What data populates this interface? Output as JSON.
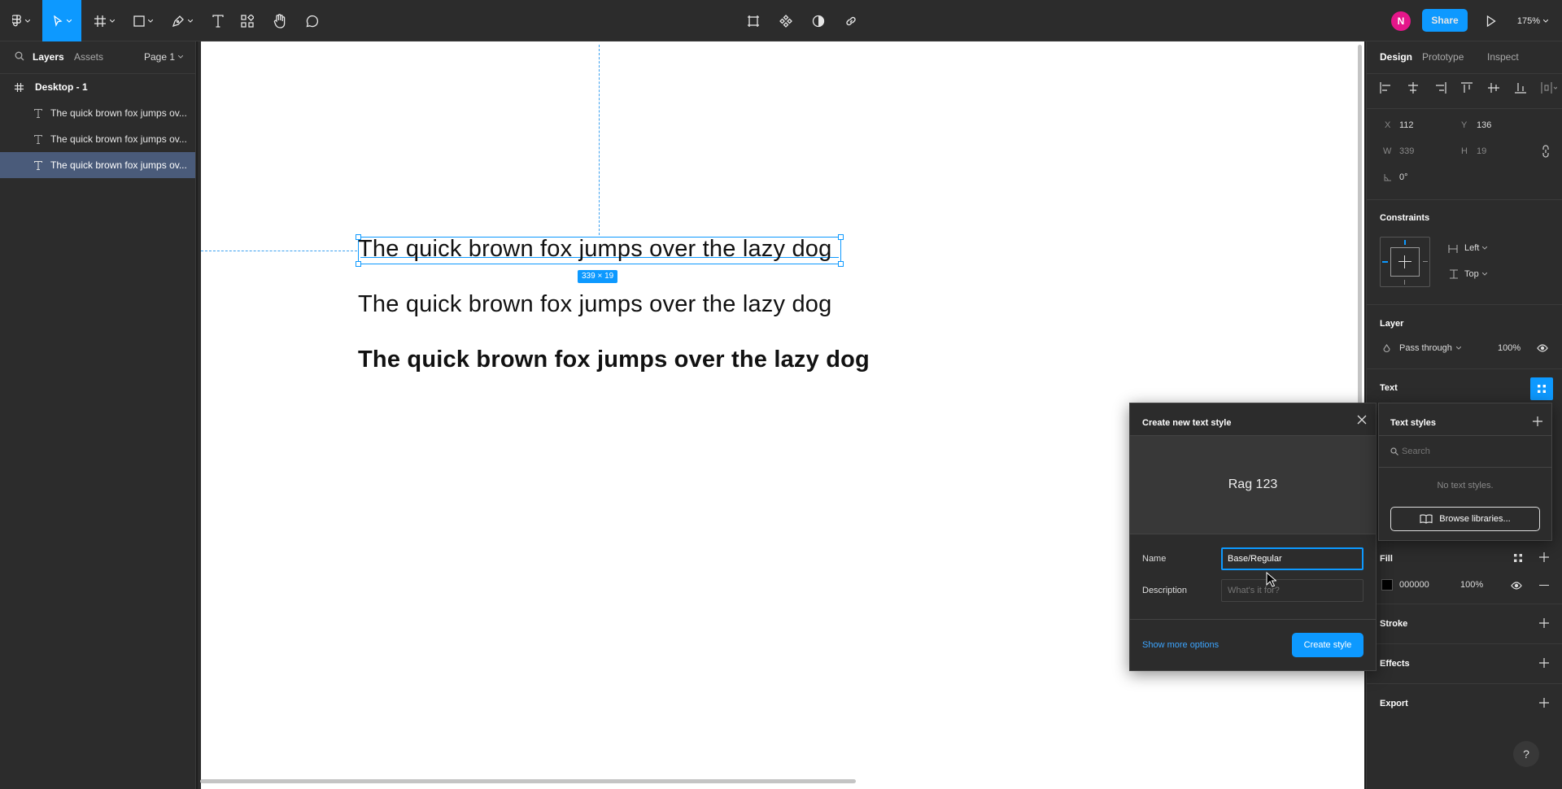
{
  "toolbar": {
    "share_label": "Share",
    "zoom_label": "175%",
    "avatar_initial": "N"
  },
  "left_panel": {
    "tab_layers": "Layers",
    "tab_assets": "Assets",
    "page_label": "Page 1",
    "frame_name": "Desktop - 1",
    "layers": [
      {
        "label": "The quick brown fox jumps ov..."
      },
      {
        "label": "The quick brown fox jumps ov..."
      },
      {
        "label": "The quick brown fox jumps ov..."
      }
    ]
  },
  "canvas": {
    "texts": [
      "The quick brown fox jumps over the lazy dog",
      "The quick brown fox jumps over the lazy dog",
      "The quick brown fox jumps over the lazy dog"
    ],
    "size_badge": "339 × 19"
  },
  "right_panel": {
    "tab_design": "Design",
    "tab_prototype": "Prototype",
    "tab_inspect": "Inspect",
    "x_label": "X",
    "x_value": "112",
    "y_label": "Y",
    "y_value": "136",
    "w_label": "W",
    "w_value": "339",
    "h_label": "H",
    "h_value": "19",
    "rotation_value": "0°",
    "constraints_title": "Constraints",
    "constraint_h": "Left",
    "constraint_v": "Top",
    "layer_title": "Layer",
    "blend_mode": "Pass through",
    "layer_opacity": "100%",
    "text_title": "Text",
    "fill_title": "Fill",
    "fill_hex": "000000",
    "fill_opacity": "100%",
    "stroke_title": "Stroke",
    "effects_title": "Effects",
    "export_title": "Export",
    "help_label": "?"
  },
  "dialog": {
    "title": "Create new text style",
    "preview_text": "Rag 123",
    "name_label": "Name",
    "name_value": "Base/Regular",
    "description_label": "Description",
    "description_placeholder": "What's it for?",
    "more_options": "Show more options",
    "create_button": "Create style"
  },
  "text_styles": {
    "title": "Text styles",
    "search_placeholder": "Search",
    "empty_text": "No text styles.",
    "browse_button": "Browse libraries..."
  },
  "colors": {
    "accent": "#0d99ff",
    "selected_layer": "#4a5b7a",
    "panel": "#2c2c2c",
    "avatar": "#e5168a"
  }
}
